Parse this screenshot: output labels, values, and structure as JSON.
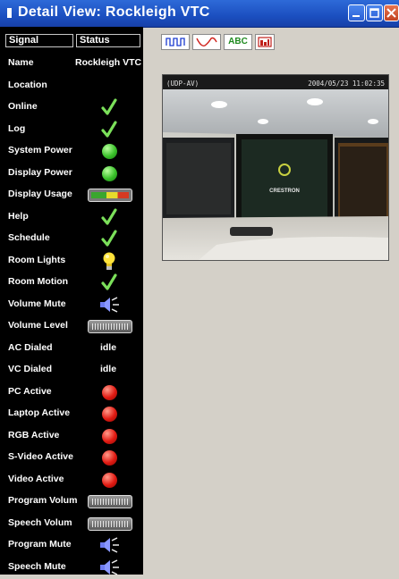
{
  "window": {
    "title": "Detail View: Rockleigh VTC"
  },
  "table": {
    "headers": {
      "signal": "Signal",
      "status": "Status"
    },
    "rows": [
      {
        "label": "Name",
        "kind": "text",
        "value": "Rockleigh VTC"
      },
      {
        "label": "Location",
        "kind": "none"
      },
      {
        "label": "Online",
        "kind": "check"
      },
      {
        "label": "Log",
        "kind": "check"
      },
      {
        "label": "System Power",
        "kind": "green-dot"
      },
      {
        "label": "Display Power",
        "kind": "green-dot"
      },
      {
        "label": "Display Usage",
        "kind": "usage-meter"
      },
      {
        "label": "Help",
        "kind": "check"
      },
      {
        "label": "Schedule",
        "kind": "check"
      },
      {
        "label": "Room Lights",
        "kind": "bulb"
      },
      {
        "label": "Room Motion",
        "kind": "check"
      },
      {
        "label": "Volume Mute",
        "kind": "speaker"
      },
      {
        "label": "Volume Level",
        "kind": "level-meter"
      },
      {
        "label": "AC Dialed",
        "kind": "text",
        "value": "idle"
      },
      {
        "label": "VC Dialed",
        "kind": "text",
        "value": "idle"
      },
      {
        "label": "PC Active",
        "kind": "red-dot"
      },
      {
        "label": "Laptop Active",
        "kind": "red-dot"
      },
      {
        "label": "RGB Active",
        "kind": "red-dot"
      },
      {
        "label": "S-Video Active",
        "kind": "red-dot"
      },
      {
        "label": "Video Active",
        "kind": "red-dot"
      },
      {
        "label": "Program Volum",
        "kind": "level-meter"
      },
      {
        "label": "Speech Volum",
        "kind": "level-meter"
      },
      {
        "label": "Program Mute",
        "kind": "speaker"
      },
      {
        "label": "Speech Mute",
        "kind": "speaker"
      }
    ]
  },
  "toolbar": {
    "buttons": [
      {
        "name": "pulse-wave-icon",
        "label": ""
      },
      {
        "name": "signal-curve-icon",
        "label": ""
      },
      {
        "name": "text-view-button",
        "label": "ABC"
      },
      {
        "name": "picture-view-icon",
        "label": ""
      }
    ]
  },
  "video": {
    "source": "(UDP-AV)",
    "timestamp": "2004/05/23 11:02:35",
    "screen_logo": "CRESTRON"
  },
  "colors": {
    "titlebar": "#1b4fc0",
    "panel": "#000000",
    "content": "#d4d0c8",
    "green": "#3ac12a",
    "red": "#e11a12"
  }
}
